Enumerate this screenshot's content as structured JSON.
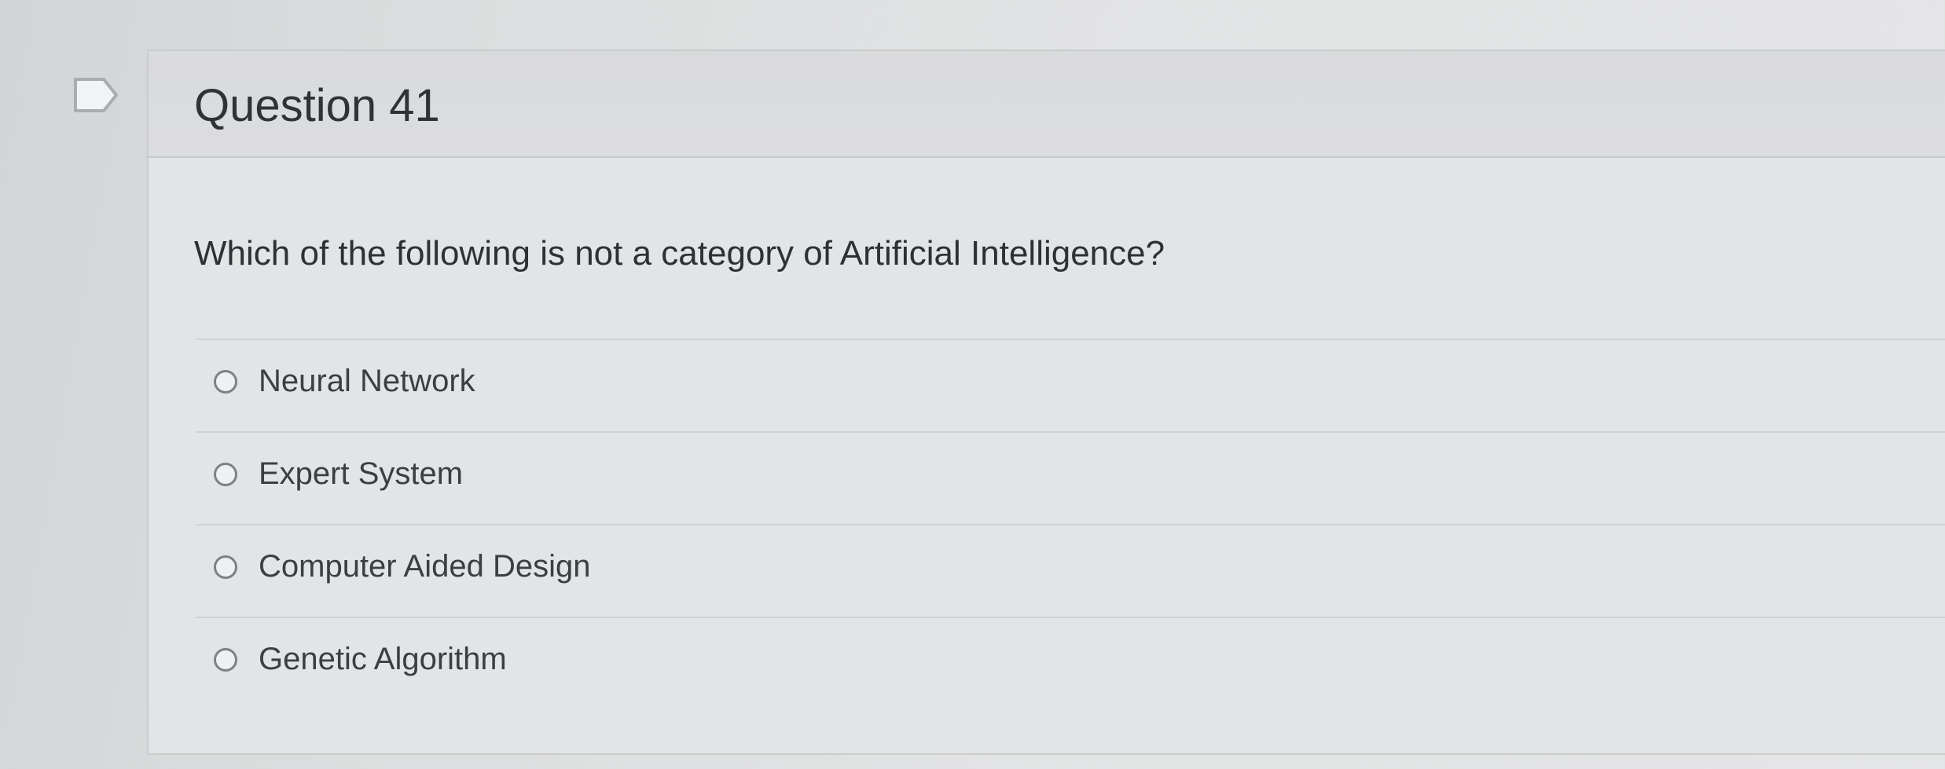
{
  "question": {
    "title": "Question 41",
    "text": "Which of the following is not a category of Artificial Intelligence?",
    "options": [
      "Neural Network",
      "Expert System",
      "Computer Aided Design",
      "Genetic Algorithm"
    ]
  },
  "icons": {
    "flag": "bookmark-flag-icon",
    "radio": "radio-button-unselected"
  }
}
